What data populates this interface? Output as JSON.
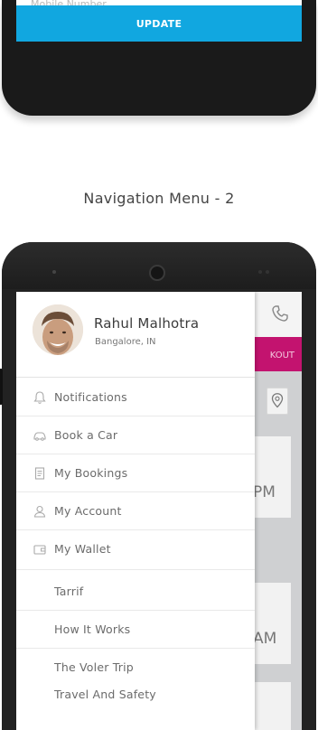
{
  "top_phone": {
    "faded_field": "Mobile Number",
    "update_button": "UPDATE"
  },
  "section_title": "Navigation Menu - 2",
  "profile": {
    "name": "Rahul Malhotra",
    "location": "Bangalore, IN"
  },
  "menu": {
    "main_items": [
      {
        "label": "Notifications",
        "icon": "bell-icon"
      },
      {
        "label": "Book a Car",
        "icon": "car-icon"
      },
      {
        "label": "My Bookings",
        "icon": "document-icon"
      },
      {
        "label": "My Account",
        "icon": "user-icon"
      },
      {
        "label": "My Wallet",
        "icon": "wallet-icon"
      }
    ],
    "secondary_items": [
      {
        "label": "Tarrif"
      },
      {
        "label": "How It Works"
      },
      {
        "label": "The Voler Trip"
      },
      {
        "label": "Travel And Safety"
      }
    ]
  },
  "background_app": {
    "checkout_label": "KOUT",
    "time_1": "PM",
    "time_2": "AM"
  },
  "colors": {
    "update_button": "#11a7e0",
    "checkout_bar": "#c3136f",
    "drawer": "#ffffff"
  }
}
